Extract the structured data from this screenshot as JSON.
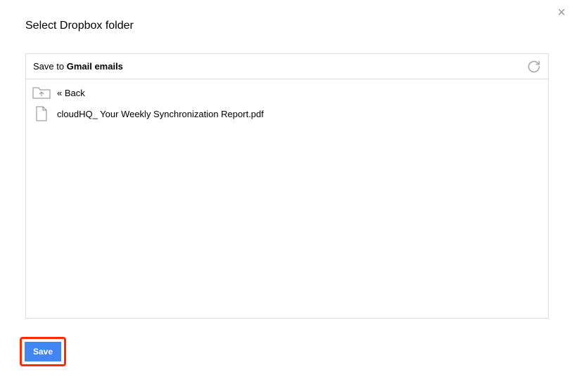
{
  "close_glyph": "×",
  "title": "Select Dropbox folder",
  "path": {
    "prefix": "Save to ",
    "folder": "Gmail emails"
  },
  "back_label": "« Back",
  "file_name": "cloudHQ_ Your Weekly Synchronization Report.pdf",
  "save_label": "Save"
}
